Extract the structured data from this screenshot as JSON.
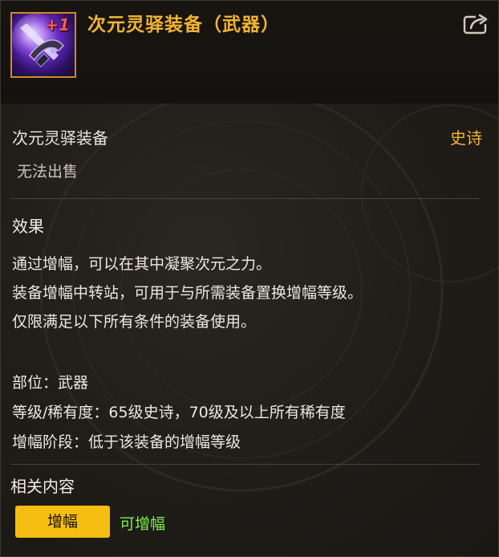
{
  "header": {
    "title": "次元灵驿装备（武器）",
    "badge": "+1",
    "share_icon": "share-export-icon"
  },
  "item": {
    "name": "次元灵驿装备",
    "rarity": "史诗",
    "sell_status": "无法出售"
  },
  "effect": {
    "label": "效果",
    "lines": [
      "通过增幅，可以在其中凝聚次元之力。",
      "装备增幅中转站，可用于与所需装备置换增幅等级。",
      "仅限满足以下所有条件的装备使用。"
    ],
    "conditions": [
      "部位：武器",
      "等级/稀有度：65级史诗，70级及以上所有稀有度",
      "增幅阶段：低于该装备的增幅等级"
    ]
  },
  "related": {
    "label": "相关内容",
    "button_label": "增幅",
    "status": "可增幅"
  },
  "colors": {
    "title": "#f0b432",
    "rarity": "#f0b432",
    "button": "#f5bd10",
    "status_green": "#7cf24a",
    "icon_border": "#d28a1e"
  }
}
